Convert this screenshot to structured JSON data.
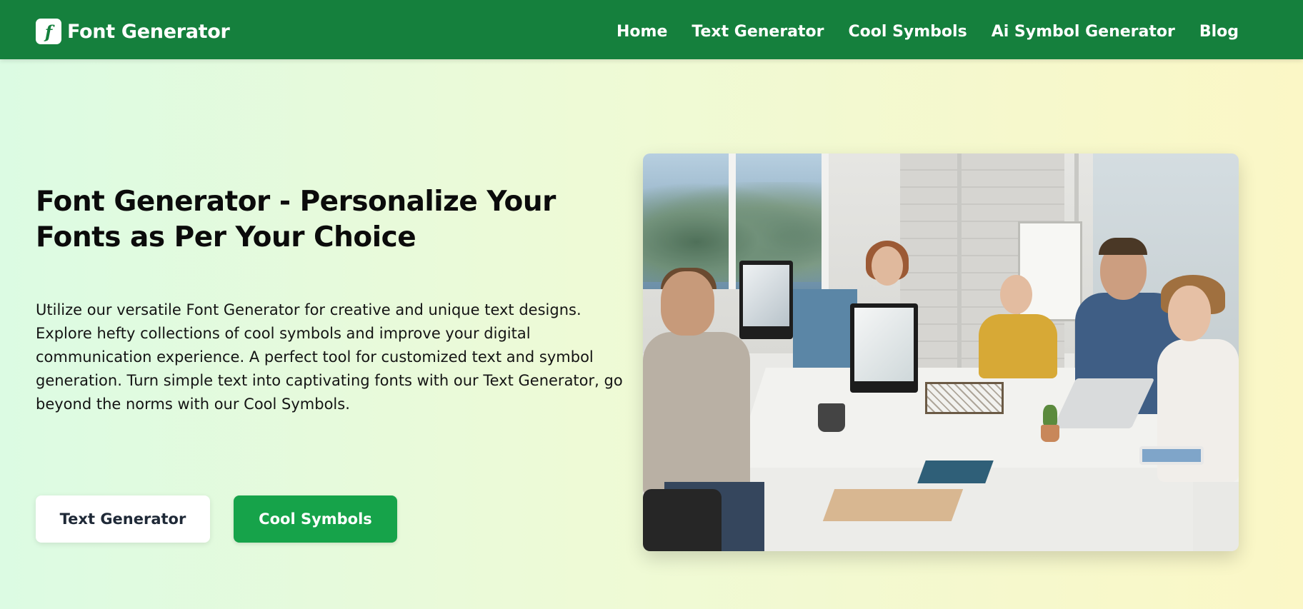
{
  "header": {
    "brand_icon_glyph": "f",
    "brand_name": "Font Generator",
    "nav": [
      {
        "label": "Home"
      },
      {
        "label": "Text Generator"
      },
      {
        "label": "Cool Symbols"
      },
      {
        "label": "Ai Symbol Generator"
      },
      {
        "label": "Blog"
      }
    ]
  },
  "hero": {
    "title": "Font Generator - Personalize Your Fonts as Per Your Choice",
    "description": "Utilize our versatile Font Generator for creative and unique text designs. Explore hefty collections of cool symbols and improve your digital communication experience. A perfect tool for customized text and symbol generation. Turn simple text into captivating fonts with our Text Generator, go beyond the norms with our Cool Symbols.",
    "buttons": {
      "secondary_label": "Text Generator",
      "primary_label": "Cool Symbols"
    },
    "image_alt": "people working together at computers in an office"
  },
  "colors": {
    "header_bg": "#15803d",
    "primary_button": "#16a34a",
    "page_gradient_start": "#dcfbe3",
    "page_gradient_end": "#fbf7c6"
  }
}
